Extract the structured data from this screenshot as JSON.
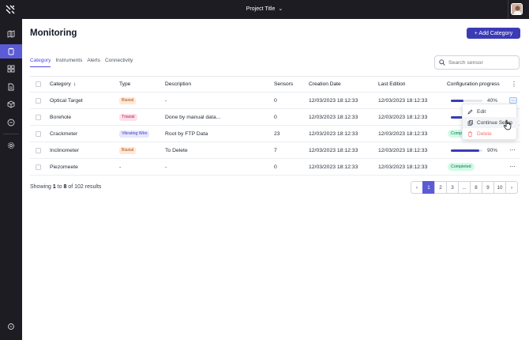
{
  "header": {
    "project_title": "Project Title"
  },
  "page": {
    "title": "Monitoring",
    "add_button_label": "+ Add Category"
  },
  "tabs": [
    {
      "label": "Category",
      "active": true
    },
    {
      "label": "Instruments",
      "active": false
    },
    {
      "label": "Alerts",
      "active": false
    },
    {
      "label": "Connectivity",
      "active": false
    }
  ],
  "search": {
    "placeholder": "Search sensor"
  },
  "table": {
    "columns": {
      "category": "Category",
      "type": "Type",
      "description": "Description",
      "sensors": "Sensors",
      "creation_date": "Creation Date",
      "last_edition": "Last Edition",
      "config_progress": "Configuration progress"
    },
    "rows": [
      {
        "category": "Optical Target",
        "type": "Biaxial",
        "description": "-",
        "sensors": "0",
        "creation_date": "12/03/2023 18:12:33",
        "last_edition": "12/03/2023 18:12:33",
        "progress_value": 0.4,
        "progress_label": "40%"
      },
      {
        "category": "Borehole",
        "type": "Triaxial",
        "description": "Done by manual data...",
        "sensors": "0",
        "creation_date": "12/03/2023 18:12:33",
        "last_edition": "12/03/2023 18:12:33",
        "progress_value": 0.4,
        "progress_label": ""
      },
      {
        "category": "Crackmeter",
        "type": "Vibrating Wire",
        "description": "Root by FTP Data",
        "sensors": "23",
        "creation_date": "12/03/2023 18:12:33",
        "last_edition": "12/03/2023 18:12:33",
        "status": "Comp"
      },
      {
        "category": "Inclinometer",
        "type": "Biaxial",
        "description": "To Delete",
        "sensors": "7",
        "creation_date": "12/03/2023 18:12:33",
        "last_edition": "12/03/2023 18:12:33",
        "progress_value": 0.9,
        "progress_label": "90%"
      },
      {
        "category": "Piezomeete",
        "type": "-",
        "description": "-",
        "sensors": "0",
        "creation_date": "12/03/2023 18:12:33",
        "last_edition": "12/03/2023 18:12:33",
        "status": "Completed"
      }
    ]
  },
  "context_menu": {
    "edit": "Edit",
    "continue_setup": "Continue Setup",
    "delete": "Delete"
  },
  "footer": {
    "prefix": "Showing",
    "from": "1",
    "to_word": "to",
    "to": "8",
    "of_word": "of",
    "total": "102",
    "suffix": "results"
  },
  "pagination": {
    "prev": "‹",
    "pages": [
      "1",
      "2",
      "3",
      "...",
      "8",
      "9",
      "10"
    ],
    "next": "›",
    "active_page": "1"
  },
  "colors": {
    "accent": "#5b5bd6",
    "sidebar_bg": "#1c1c22",
    "success": "#047857"
  }
}
